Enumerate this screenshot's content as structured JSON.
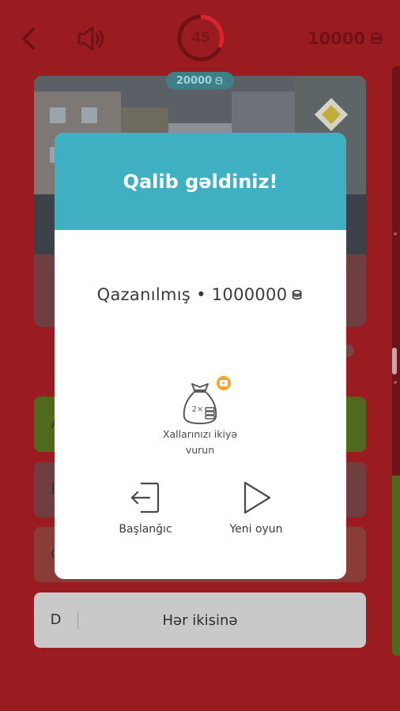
{
  "header": {
    "timer_value": "45",
    "balance": "10000",
    "prize_pill": "20000"
  },
  "answers": [
    {
      "letter": "A",
      "text": ""
    },
    {
      "letter": "B",
      "text": ""
    },
    {
      "letter": "C",
      "text": ""
    },
    {
      "letter": "D",
      "text": "Hər ikisinə"
    }
  ],
  "modal": {
    "title": "Qalib gəldiniz!",
    "earned_label": "Qazanılmış • 1000000",
    "double_label": "Xallarınızı ikiyə vurun",
    "double_multiplier": "2×",
    "home_label": "Başlanğıc",
    "new_game_label": "Yeni oyun"
  },
  "colors": {
    "background": "#9b1c20",
    "modal_header": "#3fb0c2",
    "correct_answer": "#4f6a1c",
    "video_badge": "#f5a623"
  },
  "icons": {
    "back": "chevron-left-icon",
    "sound": "speaker-icon",
    "coin": "coin-stack-icon",
    "double": "money-bag-icon",
    "video": "video-badge-icon",
    "home": "exit-icon",
    "new_game": "play-icon"
  }
}
